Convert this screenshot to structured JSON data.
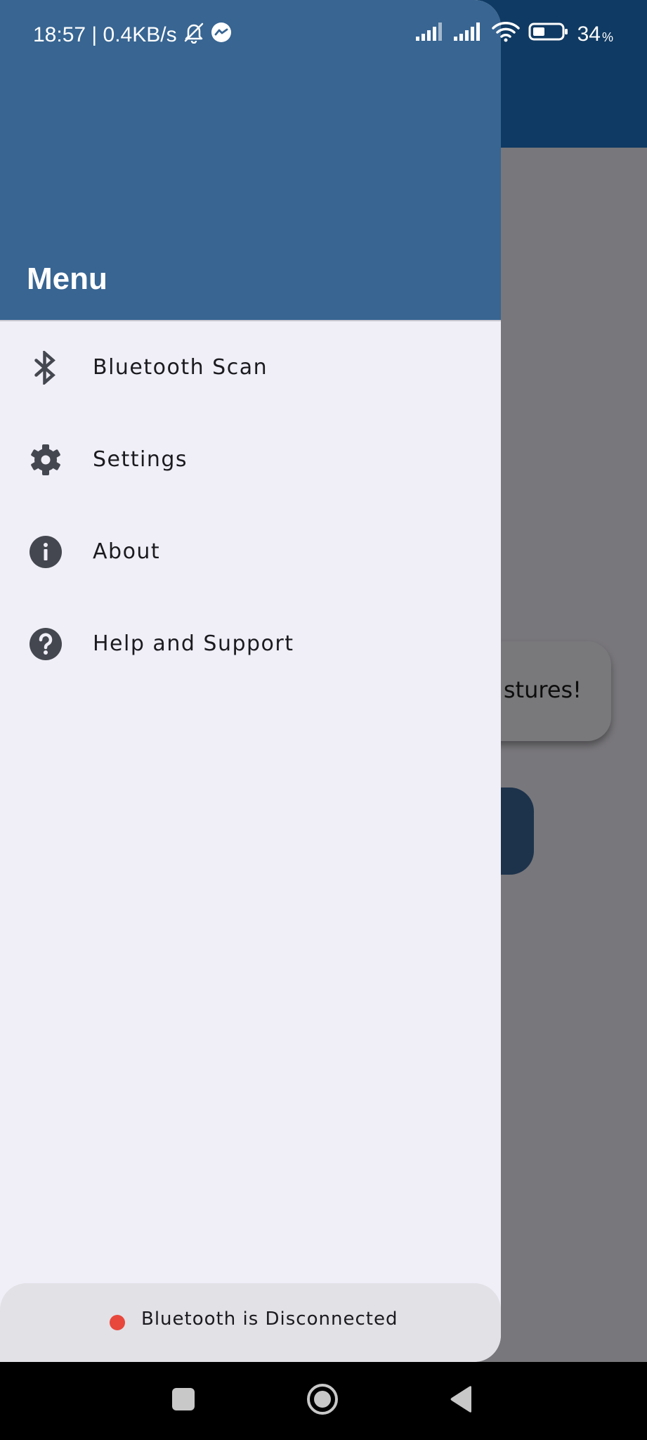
{
  "status_bar": {
    "time_speed": "18:57 | 0.4KB/s",
    "battery_level": "34",
    "battery_unit": "%"
  },
  "background": {
    "card_text": "stures!"
  },
  "drawer": {
    "title": "Menu",
    "items": [
      {
        "label": "Bluetooth Scan",
        "icon": "bluetooth-icon"
      },
      {
        "label": "Settings",
        "icon": "gear-icon"
      },
      {
        "label": "About",
        "icon": "info-icon"
      },
      {
        "label": "Help and Support",
        "icon": "help-icon"
      }
    ],
    "footer": {
      "status_text": "Bluetooth is Disconnected",
      "status_color": "#e8473c"
    }
  },
  "colors": {
    "header": "#386592",
    "app_bar": "#0f3a63",
    "icon": "#44474f"
  }
}
